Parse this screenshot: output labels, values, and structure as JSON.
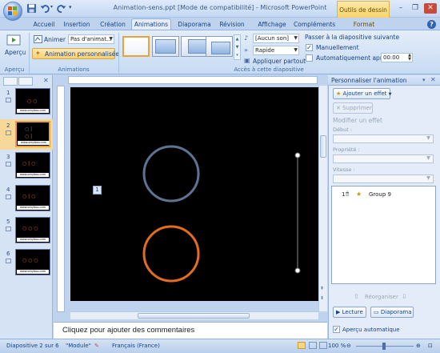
{
  "window": {
    "title": "Animation-sens.ppt [Mode de compatibilité] - Microsoft PowerPoint",
    "contextual_tab": "Outils de dessin",
    "minimize": "–",
    "restore": "❐",
    "close": "✕"
  },
  "tabs": [
    {
      "label": "Accueil"
    },
    {
      "label": "Insertion"
    },
    {
      "label": "Création"
    },
    {
      "label": "Animations"
    },
    {
      "label": "Diaporama"
    },
    {
      "label": "Révision"
    },
    {
      "label": "Affichage"
    },
    {
      "label": "Compléments"
    },
    {
      "label": "Format"
    }
  ],
  "ribbon": {
    "apercu_button": "Aperçu",
    "apercu_group": "Aperçu",
    "animer_label": "Animer :",
    "animer_value": "Pas d'animat...",
    "custom_anim_button": "Animation personnalisée",
    "animations_group": "Animations",
    "sound_value": "[Aucun son]",
    "speed_value": "Rapide",
    "apply_all": "Appliquer partout",
    "advance_title": "Passer à la diapositive suivante",
    "manual_label": "Manuellement",
    "manual_checked": true,
    "auto_label": "Automatiquement après :",
    "auto_checked": false,
    "auto_time": "00:00",
    "transition_group": "Accès à cette diapositive"
  },
  "slides": [
    {
      "num": "1",
      "has_anim": true,
      "watermark": "www.omyboo.com"
    },
    {
      "num": "2",
      "has_anim": true,
      "watermark": "www.omyboo.com",
      "selected": true
    },
    {
      "num": "3",
      "has_anim": true,
      "watermark": "www.omyboo.com"
    },
    {
      "num": "4",
      "has_anim": true,
      "watermark": "www.omyboo.com"
    },
    {
      "num": "5",
      "has_anim": true,
      "watermark": "www.omyboo.com"
    },
    {
      "num": "6",
      "has_anim": true,
      "watermark": "www.omyboo.com"
    }
  ],
  "slide": {
    "anim_tag": "1",
    "circle_top_color": "#5d7391",
    "circle_bottom_color": "#e36c1e"
  },
  "notes_placeholder": "Cliquez pour ajouter des commentaires",
  "taskpane": {
    "title": "Personnaliser l'animation",
    "add_effect": "Ajouter un effet",
    "remove": "Supprimer",
    "modify_title": "Modifier un effet",
    "start_label": "Début :",
    "property_label": "Propriété :",
    "speed_label": "Vitesse :",
    "list_items": [
      {
        "num": "1",
        "name": "Group 9"
      }
    ],
    "reorder": "Réorganiser",
    "play_button": "Lecture",
    "slideshow_button": "Diaporama",
    "autopreview_label": "Aperçu automatique",
    "autopreview_checked": true
  },
  "status": {
    "slide_info": "Diapositive 2 sur 6",
    "theme": "\"Module\"",
    "language": "Français (France)",
    "zoom": "100 %"
  }
}
